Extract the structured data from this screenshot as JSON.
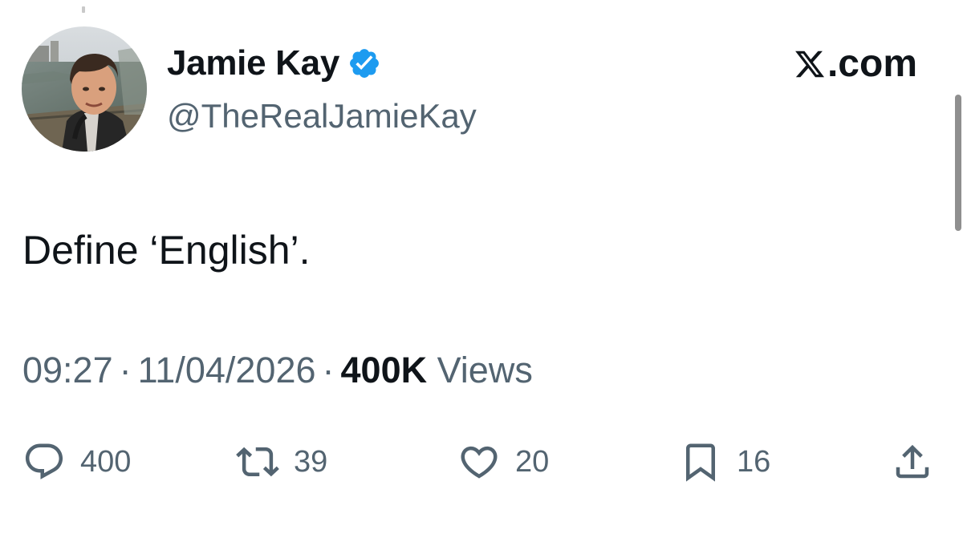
{
  "author": {
    "display_name": "Jamie Kay",
    "handle": "@TheRealJamieKay",
    "verified": true,
    "avatar_icon": "profile-photo",
    "verified_icon": "verified-badge-icon"
  },
  "brand": {
    "label": ".com",
    "icon": "x-logo-icon"
  },
  "tweet": {
    "text": "Define ‘English’."
  },
  "meta": {
    "time": "09:27",
    "date": "11/04/2026",
    "separator": "·",
    "views_count": "400K",
    "views_label": "Views"
  },
  "actions": {
    "reply": {
      "icon": "reply-icon",
      "count": "400"
    },
    "retweet": {
      "icon": "retweet-icon",
      "count": "39"
    },
    "like": {
      "icon": "heart-icon",
      "count": "20"
    },
    "bookmark": {
      "icon": "bookmark-icon",
      "count": "16"
    },
    "share": {
      "icon": "share-icon"
    }
  },
  "colors": {
    "text_primary": "#0f1419",
    "text_secondary": "#536471",
    "verified_blue": "#1d9bf0",
    "background": "#ffffff"
  }
}
